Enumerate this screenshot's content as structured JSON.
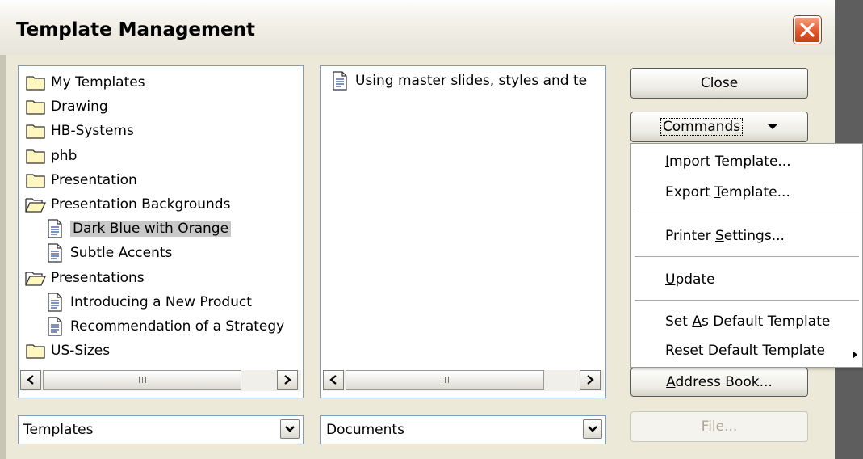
{
  "window": {
    "title": "Template Management"
  },
  "categories_list": {
    "items": [
      {
        "label": "My Templates",
        "type": "folder"
      },
      {
        "label": "Drawing",
        "type": "folder"
      },
      {
        "label": "HB-Systems",
        "type": "folder"
      },
      {
        "label": "phb",
        "type": "folder"
      },
      {
        "label": "Presentation",
        "type": "folder"
      },
      {
        "label": "Presentation Backgrounds",
        "type": "folder-open"
      },
      {
        "label": "Dark Blue with Orange",
        "type": "document",
        "selected": true
      },
      {
        "label": "Subtle Accents",
        "type": "document"
      },
      {
        "label": "Presentations",
        "type": "folder-open"
      },
      {
        "label": "Introducing a New Product",
        "type": "document"
      },
      {
        "label": "Recommendation of a Strategy",
        "type": "document"
      },
      {
        "label": "US-Sizes",
        "type": "folder"
      }
    ]
  },
  "documents_list": {
    "items": [
      {
        "label": "Using master slides, styles and te",
        "type": "document"
      }
    ]
  },
  "buttons": {
    "close": "Close",
    "commands": "Commands",
    "address_book": "Address Book...",
    "file": "File..."
  },
  "combos": {
    "left": "Templates",
    "right": "Documents"
  },
  "commands_menu": {
    "import": "Import Template...",
    "export": "Export Template...",
    "printer": "Printer Settings...",
    "update": "Update",
    "set_default": "Set As Default Template",
    "reset_default": "Reset Default Template"
  }
}
